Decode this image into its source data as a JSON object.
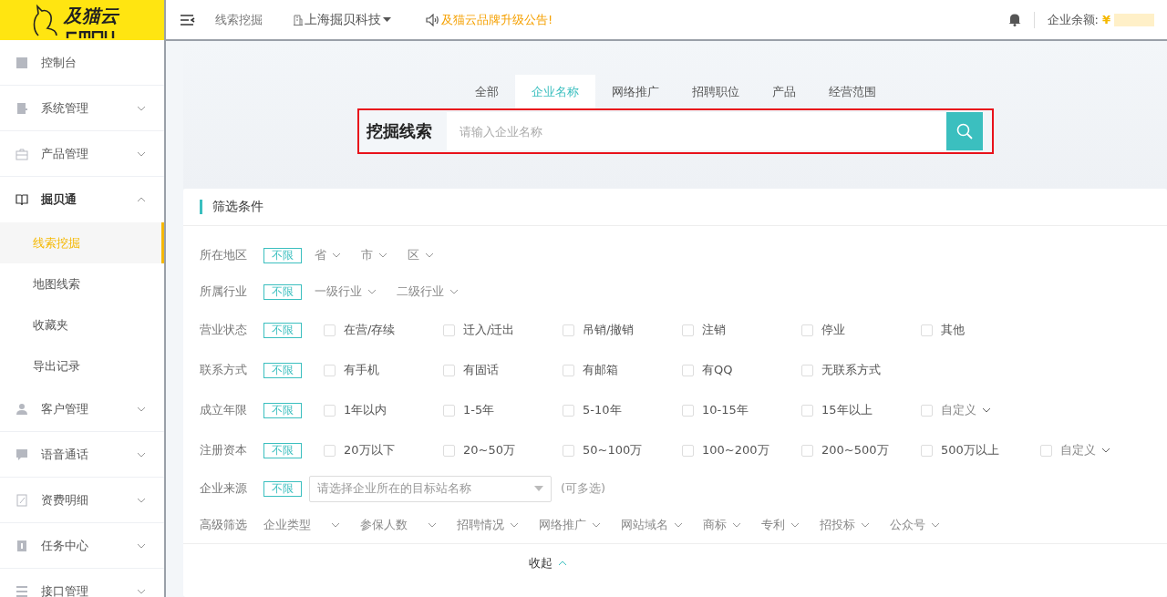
{
  "logo": {
    "text": "及猫云"
  },
  "topbar": {
    "breadcrumb": "线索挖掘",
    "company": "上海掘贝科技",
    "notice": "及猫云品牌升级公告!",
    "balance_label": "企业余额:",
    "currency": "¥"
  },
  "sidebar": {
    "items": [
      {
        "kind": "link",
        "label": "控制台"
      },
      {
        "kind": "group",
        "label": "系统管理",
        "expanded": false
      },
      {
        "kind": "group",
        "label": "产品管理",
        "expanded": false
      },
      {
        "kind": "group",
        "label": "掘贝通",
        "expanded": true,
        "children": [
          {
            "label": "线索挖掘",
            "selected": true
          },
          {
            "label": "地图线索",
            "selected": false
          },
          {
            "label": "收藏夹",
            "selected": false
          },
          {
            "label": "导出记录",
            "selected": false
          }
        ]
      },
      {
        "kind": "group",
        "label": "客户管理",
        "expanded": false
      },
      {
        "kind": "group",
        "label": "语音通话",
        "expanded": false
      },
      {
        "kind": "group",
        "label": "资费明细",
        "expanded": false
      },
      {
        "kind": "group",
        "label": "任务中心",
        "expanded": false
      },
      {
        "kind": "group",
        "label": "接口管理",
        "expanded": false
      }
    ]
  },
  "search": {
    "tabs": [
      {
        "label": "全部",
        "selected": false
      },
      {
        "label": "企业名称",
        "selected": true
      },
      {
        "label": "网络推广",
        "selected": false
      },
      {
        "label": "招聘职位",
        "selected": false
      },
      {
        "label": "产品",
        "selected": false
      },
      {
        "label": "经营范围",
        "selected": false
      }
    ],
    "title": "挖掘线索",
    "placeholder": "请输入企业名称"
  },
  "filters": {
    "title": "筛选条件",
    "rows": [
      {
        "kind": "dropdowns",
        "label": "所在地区",
        "any": {
          "label": "不限",
          "selected": true
        },
        "options": [
          "省",
          "市",
          "区"
        ]
      },
      {
        "kind": "dropdowns",
        "label": "所属行业",
        "any": {
          "label": "不限",
          "selected": true
        },
        "options": [
          "一级行业",
          "二级行业"
        ]
      },
      {
        "kind": "checks",
        "label": "营业状态",
        "any": {
          "label": "不限",
          "selected": true
        },
        "options": [
          {
            "label": "在营/存续",
            "checked": false
          },
          {
            "label": "迁入/迁出",
            "checked": false
          },
          {
            "label": "吊销/撤销",
            "checked": false
          },
          {
            "label": "注销",
            "checked": false
          },
          {
            "label": "停业",
            "checked": false
          },
          {
            "label": "其他",
            "checked": false
          }
        ]
      },
      {
        "kind": "checks",
        "label": "联系方式",
        "any": {
          "label": "不限",
          "selected": true
        },
        "options": [
          {
            "label": "有手机",
            "checked": false
          },
          {
            "label": "有固话",
            "checked": false
          },
          {
            "label": "有邮箱",
            "checked": false
          },
          {
            "label": "有QQ",
            "checked": false
          },
          {
            "label": "无联系方式",
            "checked": false
          }
        ]
      },
      {
        "kind": "checks",
        "label": "成立年限",
        "any": {
          "label": "不限",
          "selected": true
        },
        "options": [
          {
            "label": "1年以内",
            "checked": false
          },
          {
            "label": "1-5年",
            "checked": false
          },
          {
            "label": "5-10年",
            "checked": false
          },
          {
            "label": "10-15年",
            "checked": false
          },
          {
            "label": "15年以上",
            "checked": false
          },
          {
            "kind": "dropdown",
            "label": "自定义",
            "checked": false
          }
        ]
      },
      {
        "kind": "checks",
        "label": "注册资本",
        "any": {
          "label": "不限",
          "selected": true
        },
        "options": [
          {
            "label": "20万以下",
            "checked": false
          },
          {
            "label": "20~50万",
            "checked": false
          },
          {
            "label": "50~100万",
            "checked": false
          },
          {
            "label": "100~200万",
            "checked": false
          },
          {
            "label": "200~500万",
            "checked": false
          },
          {
            "label": "500万以上",
            "checked": false
          },
          {
            "kind": "dropdown",
            "label": "自定义",
            "checked": false
          }
        ]
      },
      {
        "kind": "select",
        "label": "企业来源",
        "any": {
          "label": "不限",
          "selected": true
        },
        "placeholder": "请选择企业所在的目标站名称",
        "hint": "(可多选)"
      },
      {
        "kind": "advanced",
        "label": "高级筛选",
        "options": [
          "企业类型",
          "参保人数",
          "招聘情况",
          "网络推广",
          "网站域名",
          "商标",
          "专利",
          "招投标",
          "公众号"
        ]
      }
    ],
    "collapse": "收起"
  }
}
